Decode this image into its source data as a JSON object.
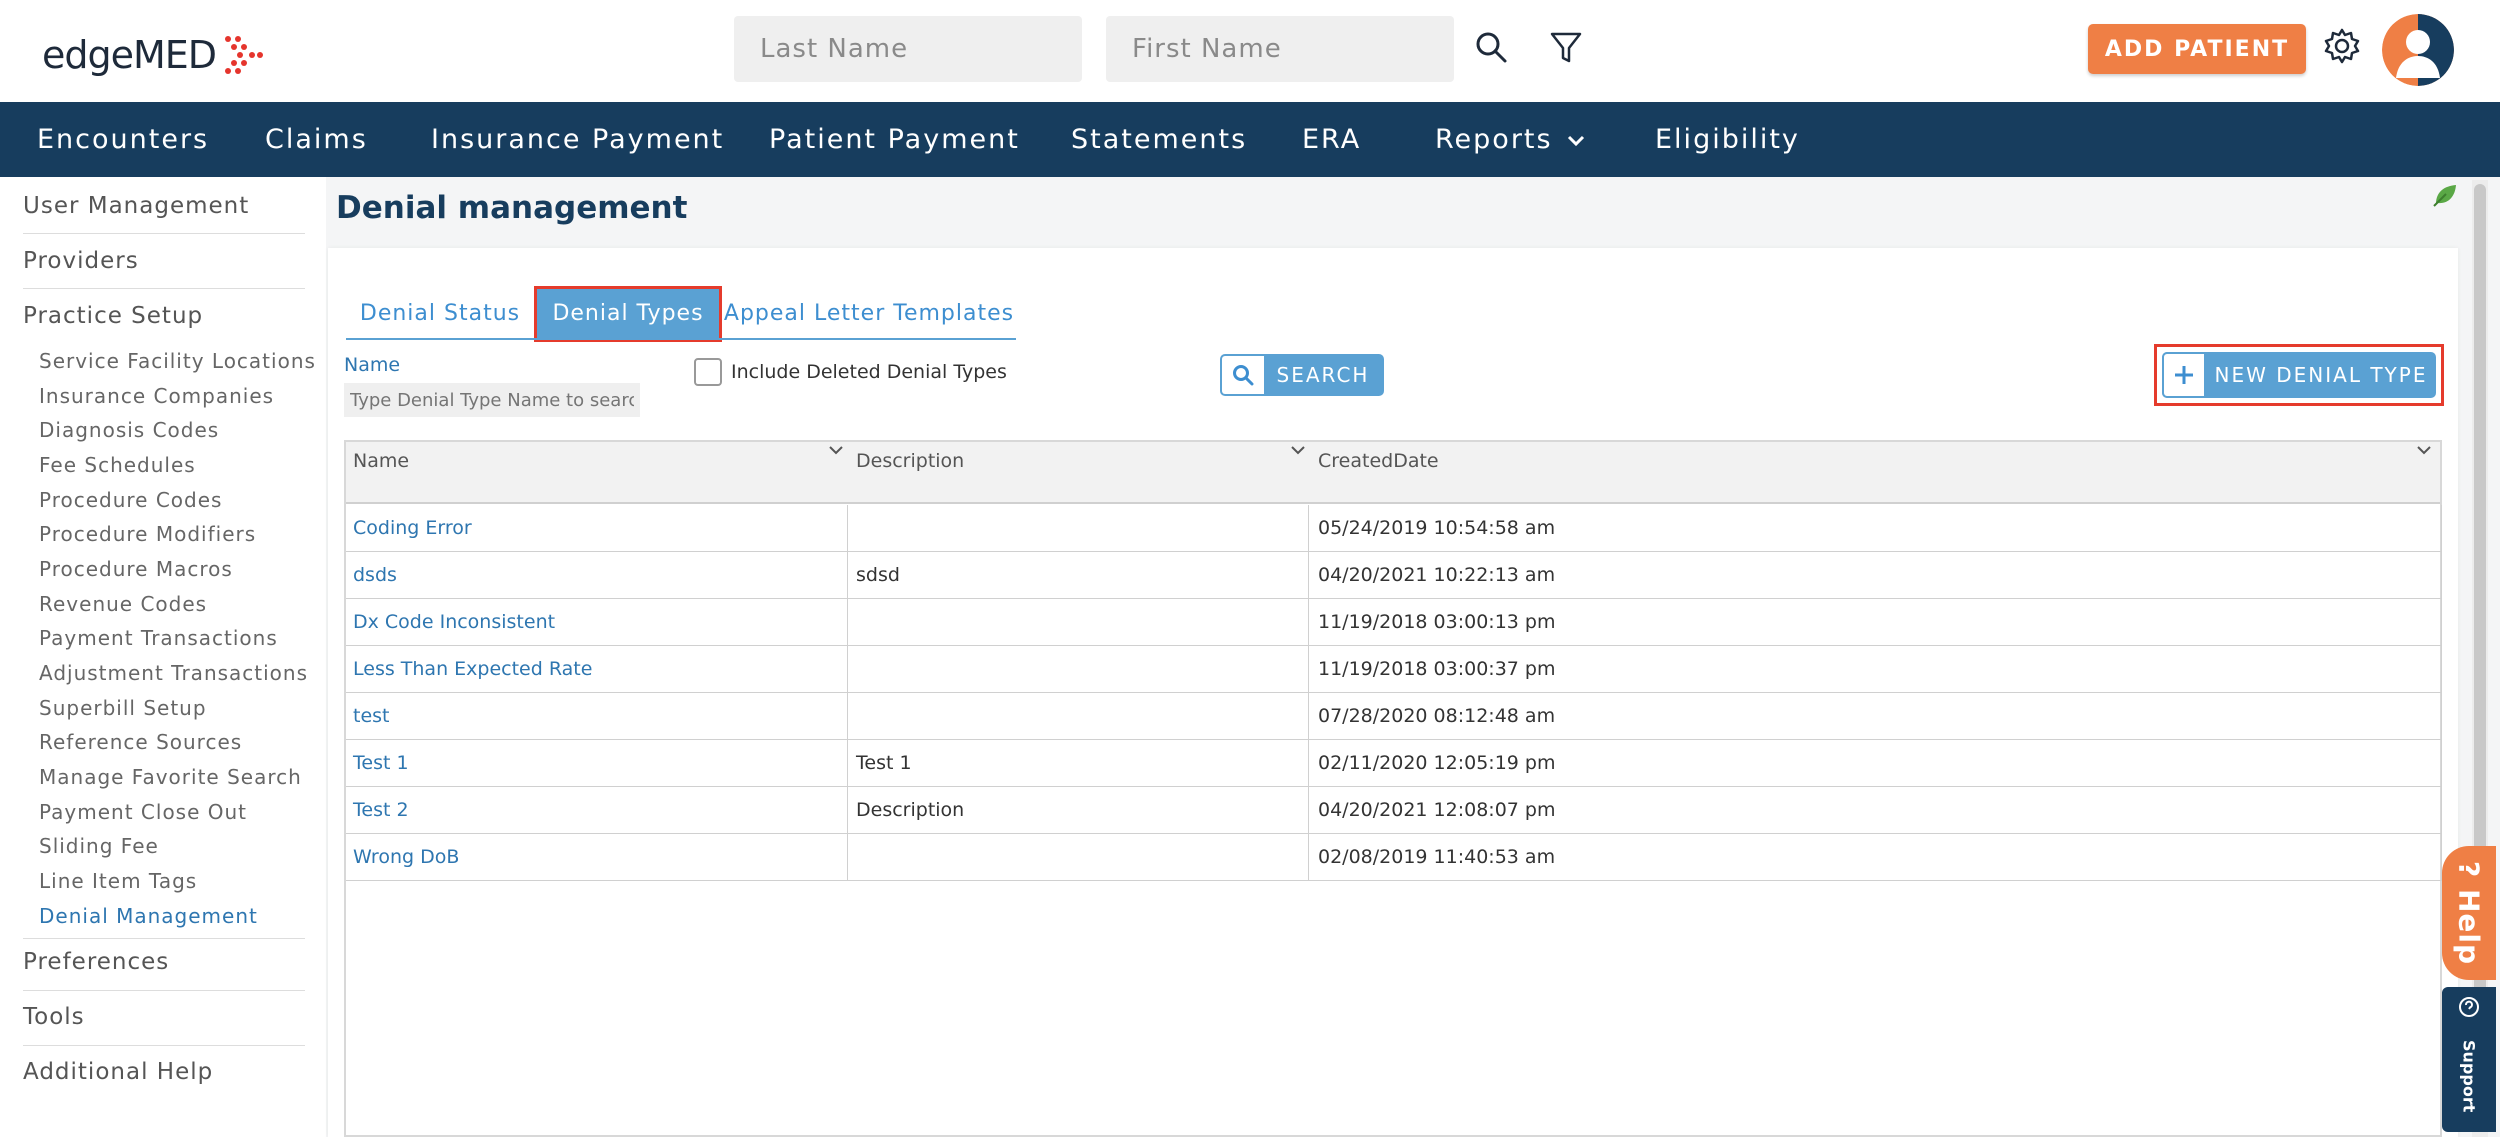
{
  "header": {
    "logo_text": "edgeMED",
    "last_name_placeholder": "Last Name",
    "first_name_placeholder": "First Name",
    "add_patient_label": "ADD PATIENT"
  },
  "nav": {
    "items": [
      "Encounters",
      "Claims",
      "Insurance Payment",
      "Patient Payment",
      "Statements",
      "ERA",
      "Reports",
      "Eligibility"
    ]
  },
  "sidebar": {
    "sections": {
      "user_management": "User Management",
      "providers": "Providers",
      "practice_setup": "Practice Setup",
      "preferences": "Preferences",
      "tools": "Tools",
      "additional_help": "Additional Help"
    },
    "practice_items": [
      "Service Facility Locations",
      "Insurance Companies",
      "Diagnosis Codes",
      "Fee Schedules",
      "Procedure Codes",
      "Procedure Modifiers",
      "Procedure Macros",
      "Revenue Codes",
      "Payment Transactions",
      "Adjustment Transactions",
      "Superbill Setup",
      "Reference Sources",
      "Manage Favorite Search",
      "Payment Close Out",
      "Sliding Fee",
      "Line Item Tags",
      "Denial Management"
    ],
    "active_item": "Denial Management"
  },
  "page": {
    "title": "Denial management",
    "tabs": [
      "Denial Status",
      "Denial Types",
      "Appeal Letter Templates"
    ],
    "active_tab": "Denial Types"
  },
  "filters": {
    "name_label": "Name",
    "name_placeholder": "Type Denial Type Name to search",
    "include_deleted_label": "Include Deleted Denial Types",
    "include_deleted_checked": false,
    "search_label": "SEARCH",
    "new_label": "NEW DENIAL TYPE"
  },
  "table": {
    "columns": [
      "Name",
      "Description",
      "CreatedDate"
    ],
    "rows": [
      {
        "name": "Coding Error",
        "description": "",
        "created": "05/24/2019 10:54:58 am"
      },
      {
        "name": "dsds",
        "description": "sdsd",
        "created": "04/20/2021 10:22:13 am"
      },
      {
        "name": "Dx Code Inconsistent",
        "description": "",
        "created": "11/19/2018 03:00:13 pm"
      },
      {
        "name": "Less Than Expected Rate",
        "description": "",
        "created": "11/19/2018 03:00:37 pm"
      },
      {
        "name": "test",
        "description": "",
        "created": "07/28/2020 08:12:48 am"
      },
      {
        "name": "Test 1",
        "description": "Test 1",
        "created": "02/11/2020 12:05:19 pm"
      },
      {
        "name": "Test 2",
        "description": "Description",
        "created": "04/20/2021 12:08:07 pm"
      },
      {
        "name": "Wrong DoB",
        "description": "",
        "created": "02/08/2019 11:40:53 am"
      }
    ]
  },
  "widgets": {
    "help_label": "? Help",
    "support_label": "Support"
  },
  "colors": {
    "nav_bg": "#173d5e",
    "accent_orange": "#ef7f45",
    "accent_blue": "#5aa1d3",
    "link_blue": "#2e76b0",
    "highlight_red": "#e53b2c"
  }
}
